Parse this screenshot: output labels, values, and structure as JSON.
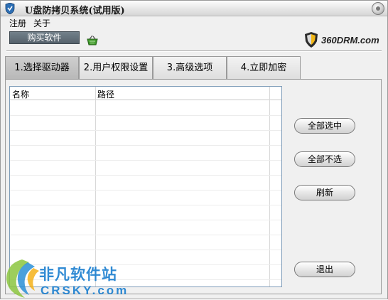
{
  "window": {
    "title": "U盘防拷贝系统(试用版)"
  },
  "menu": {
    "items": [
      "注册",
      "关于"
    ]
  },
  "buy_button": "购买软件",
  "logo": {
    "text": "360DRM.com"
  },
  "tabs": [
    {
      "label": "1.选择驱动器",
      "active": true
    },
    {
      "label": "2.用户权限设置",
      "active": false
    },
    {
      "label": "3.高级选项",
      "active": false
    },
    {
      "label": "4.立即加密",
      "active": false
    }
  ],
  "list": {
    "columns": [
      "名称",
      "路径"
    ],
    "rows": []
  },
  "buttons": {
    "select_all": "全部选中",
    "select_none": "全部不选",
    "refresh": "刷新",
    "exit": "退出"
  },
  "watermark": {
    "text_cn": "非凡软件站",
    "text_en": "CRSKY.com"
  },
  "colors": {
    "buy_button_bg": "#5f6b75",
    "watermark": "#1a7ecf",
    "list_border": "#7f9db9"
  }
}
